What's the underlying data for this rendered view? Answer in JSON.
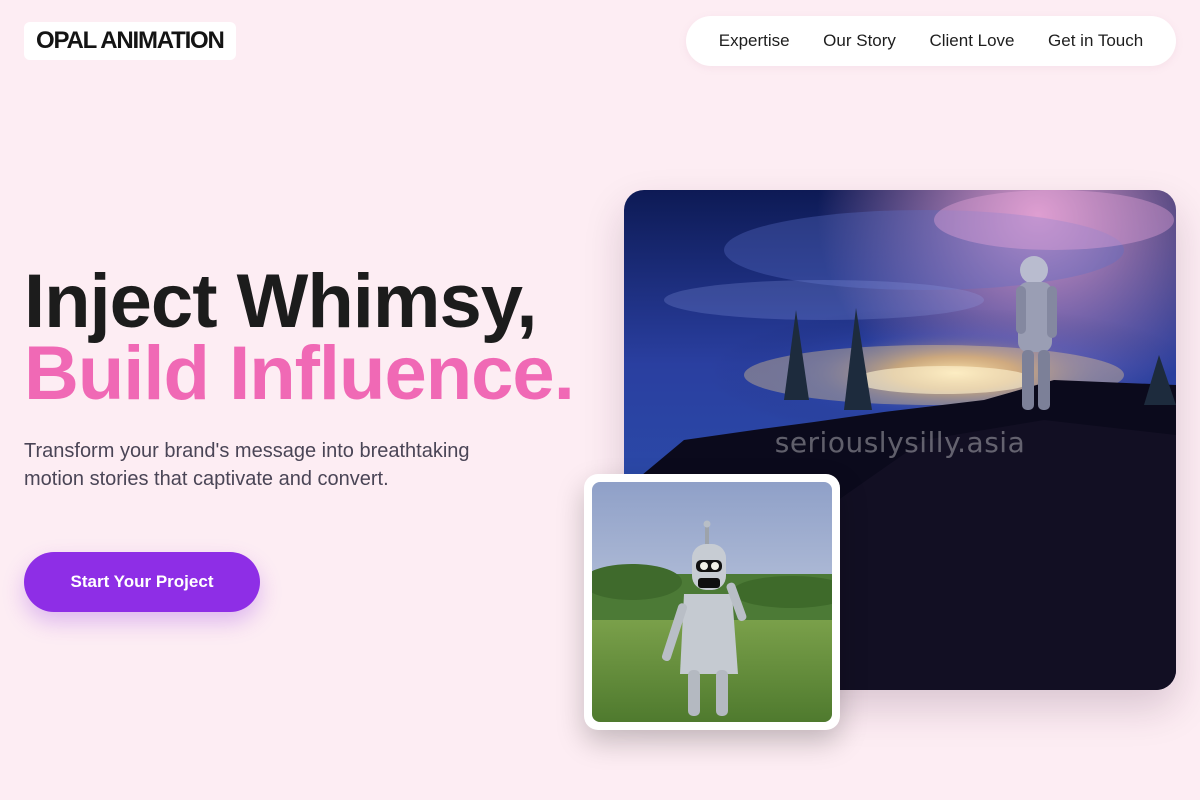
{
  "header": {
    "logo": "OPAL ANIMATION",
    "nav": [
      {
        "label": "Expertise"
      },
      {
        "label": "Our Story"
      },
      {
        "label": "Client Love"
      },
      {
        "label": "Get in Touch"
      }
    ]
  },
  "hero": {
    "headline_line1": "Inject Whimsy,",
    "headline_line2": "Build Influence.",
    "subtext": "Transform your brand's message into breathtaking motion stories that captivate and convert.",
    "cta_label": "Start Your Project",
    "image_watermark": "seriouslysilly.asia"
  },
  "colors": {
    "background": "#fdedf3",
    "accent_pink": "#f069b5",
    "cta_purple": "#8e2ee6"
  }
}
